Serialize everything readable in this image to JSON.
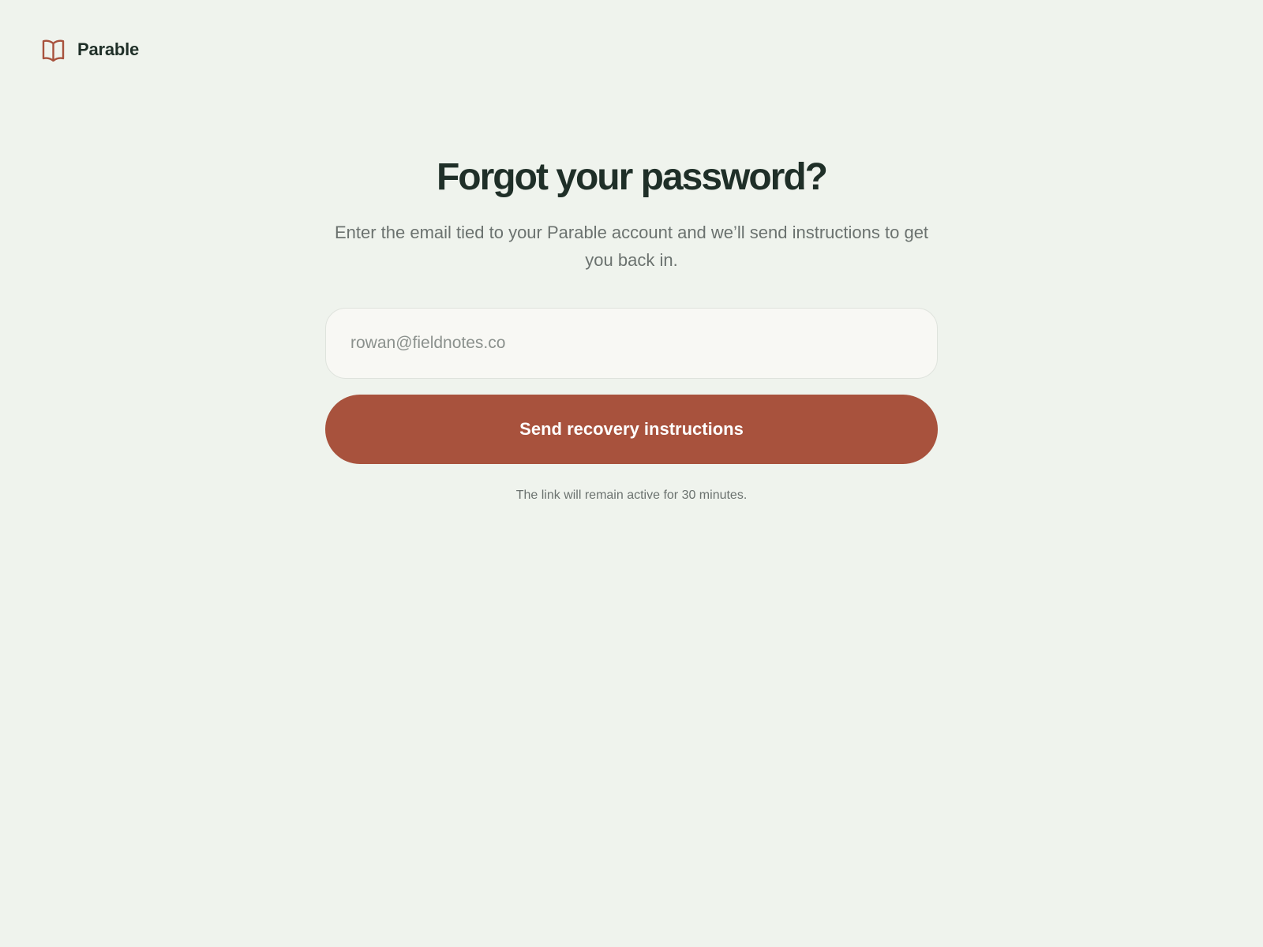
{
  "brand": {
    "name": "Parable",
    "icon": "open-book-icon",
    "icon_color": "#a8523d"
  },
  "page": {
    "title": "Forgot your password?",
    "subtitle": "Enter the email tied to your Parable account and we’ll send instructions to get you back in."
  },
  "form": {
    "email_placeholder": "rowan@fieldnotes.co",
    "email_value": "",
    "submit_label": "Send recovery instructions",
    "note": "The link will remain active for 30 minutes."
  },
  "colors": {
    "background": "#eff3ed",
    "accent": "#a8523d",
    "text": "#1f2f28",
    "muted": "#6b726f"
  }
}
